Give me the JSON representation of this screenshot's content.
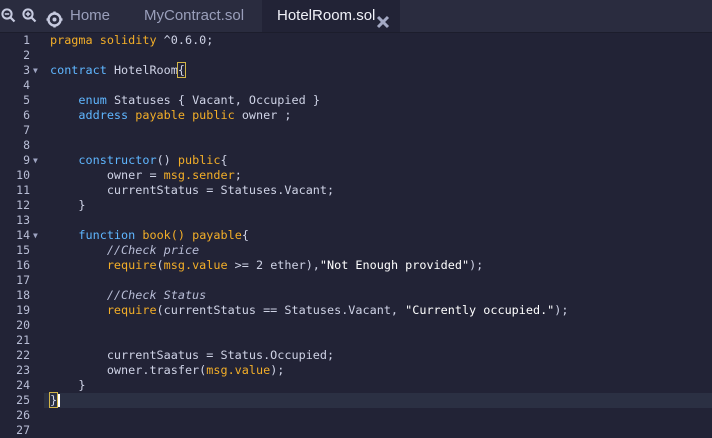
{
  "tabbar": {
    "home_label": "Home",
    "tabs": [
      {
        "label": "MyContract.sol"
      },
      {
        "label": "HotelRoom.sol",
        "active": true
      }
    ]
  },
  "editor": {
    "active_line": 25,
    "lines": [
      {
        "n": "1"
      },
      {
        "n": "2"
      },
      {
        "n": "3",
        "fold": "▼"
      },
      {
        "n": "4"
      },
      {
        "n": "5"
      },
      {
        "n": "6"
      },
      {
        "n": "7"
      },
      {
        "n": "8"
      },
      {
        "n": "9",
        "fold": "▼"
      },
      {
        "n": "10"
      },
      {
        "n": "11"
      },
      {
        "n": "12"
      },
      {
        "n": "13"
      },
      {
        "n": "14",
        "fold": "▼"
      },
      {
        "n": "15"
      },
      {
        "n": "16"
      },
      {
        "n": "17"
      },
      {
        "n": "18"
      },
      {
        "n": "19"
      },
      {
        "n": "20"
      },
      {
        "n": "21"
      },
      {
        "n": "22"
      },
      {
        "n": "23"
      },
      {
        "n": "24"
      },
      {
        "n": "25"
      },
      {
        "n": "26"
      },
      {
        "n": "27"
      }
    ],
    "tokens": {
      "l1_pragma": "pragma",
      "l1_solidity": "solidity",
      "l1_version": "^0.6.0;",
      "l3_contract": "contract",
      "l3_name": "HotelRoom",
      "l3_brace": "{",
      "l5_enum": "enum",
      "l5_rest": "Statuses { Vacant, Occupied }",
      "l6_address": "address",
      "l6_payable": "payable",
      "l6_public": "public",
      "l6_rest": "owner ;",
      "l9_constructor": "constructor",
      "l9_parens": "()",
      "l9_public": "public",
      "l9_brace": "{",
      "l10_a": "owner = ",
      "l10_msg": "msg.sender",
      "l10_b": ";",
      "l11": "currentStatus = Statuses.Vacant;",
      "l12": "}",
      "l14_function": "function",
      "l14_name": "book()",
      "l14_payable": "payable",
      "l14_brace": "{",
      "l15_comment": "//Check price",
      "l16_require": "require",
      "l16_a": "(",
      "l16_msg": "msg.value",
      "l16_b": " >= 2 ether),",
      "l16_str": "\"Not Enough provided\"",
      "l16_c": ");",
      "l18_comment": "//Check Status",
      "l19_require": "require",
      "l19_a": "(currentStatus == Statuses.Vacant, ",
      "l19_str": "\"Currently occupied.\"",
      "l19_b": ");",
      "l22": "currentSaatus = Status.Occupied;",
      "l23_a": "owner.trasfer(",
      "l23_msg": "msg.value",
      "l23_b": ");",
      "l24": "}",
      "l25": "}"
    }
  },
  "colors": {
    "background": "#222336",
    "tabbar": "#2a2c3f",
    "keyword": "#f3ae28",
    "type": "#5fb6ff",
    "active_line": "#2b3043"
  },
  "icons": [
    "zoom-out-icon",
    "zoom-in-icon",
    "home-icon",
    "close-icon"
  ]
}
